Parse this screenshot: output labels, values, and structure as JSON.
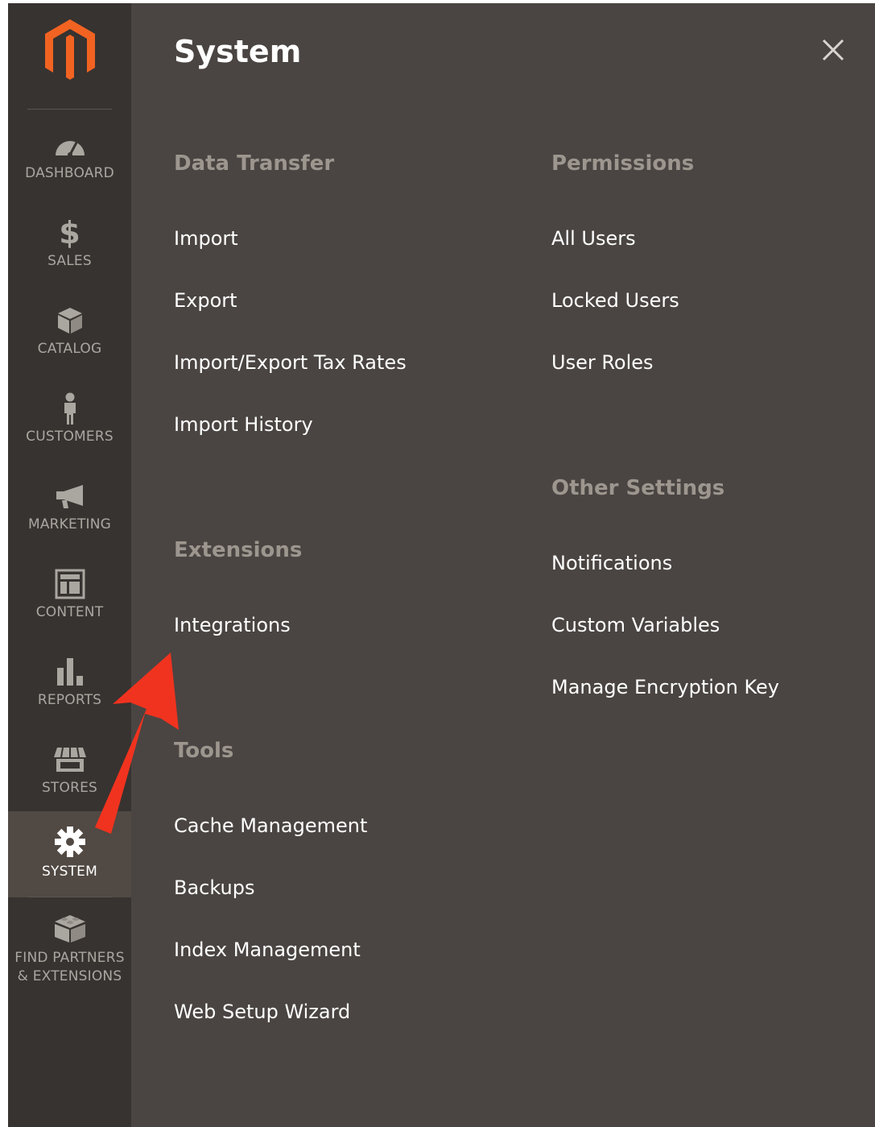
{
  "sidebar": {
    "logo": "magento-logo",
    "items": [
      {
        "label": "DASHBOARD",
        "icon": "dashboard-gauge-icon"
      },
      {
        "label": "SALES",
        "icon": "dollar-icon"
      },
      {
        "label": "CATALOG",
        "icon": "box-icon"
      },
      {
        "label": "CUSTOMERS",
        "icon": "person-icon"
      },
      {
        "label": "MARKETING",
        "icon": "megaphone-icon"
      },
      {
        "label": "CONTENT",
        "icon": "layout-icon"
      },
      {
        "label": "REPORTS",
        "icon": "bar-chart-icon"
      },
      {
        "label": "STORES",
        "icon": "storefront-icon"
      },
      {
        "label": "SYSTEM",
        "icon": "gear-icon",
        "active": true
      },
      {
        "label": "FIND PARTNERS\n& EXTENSIONS",
        "icon": "blocks-icon"
      }
    ]
  },
  "panel": {
    "title": "System",
    "close_icon": "close-icon",
    "sections": {
      "data_transfer": {
        "title": "Data Transfer",
        "links": [
          "Import",
          "Export",
          "Import/Export Tax Rates",
          "Import History"
        ]
      },
      "extensions": {
        "title": "Extensions",
        "links": [
          "Integrations"
        ]
      },
      "tools": {
        "title": "Tools",
        "links": [
          "Cache Management",
          "Backups",
          "Index Management",
          "Web Setup Wizard"
        ]
      },
      "permissions": {
        "title": "Permissions",
        "links": [
          "All Users",
          "Locked Users",
          "User Roles"
        ]
      },
      "other_settings": {
        "title": "Other Settings",
        "links": [
          "Notifications",
          "Custom Variables",
          "Manage Encryption Key"
        ]
      }
    }
  },
  "colors": {
    "sidebar_bg": "#373330",
    "panel_bg": "#4a4542",
    "active_item_bg": "#514943",
    "logo_orange": "#f26322",
    "section_title": "#9d968f",
    "arrow": "#f0331f"
  }
}
